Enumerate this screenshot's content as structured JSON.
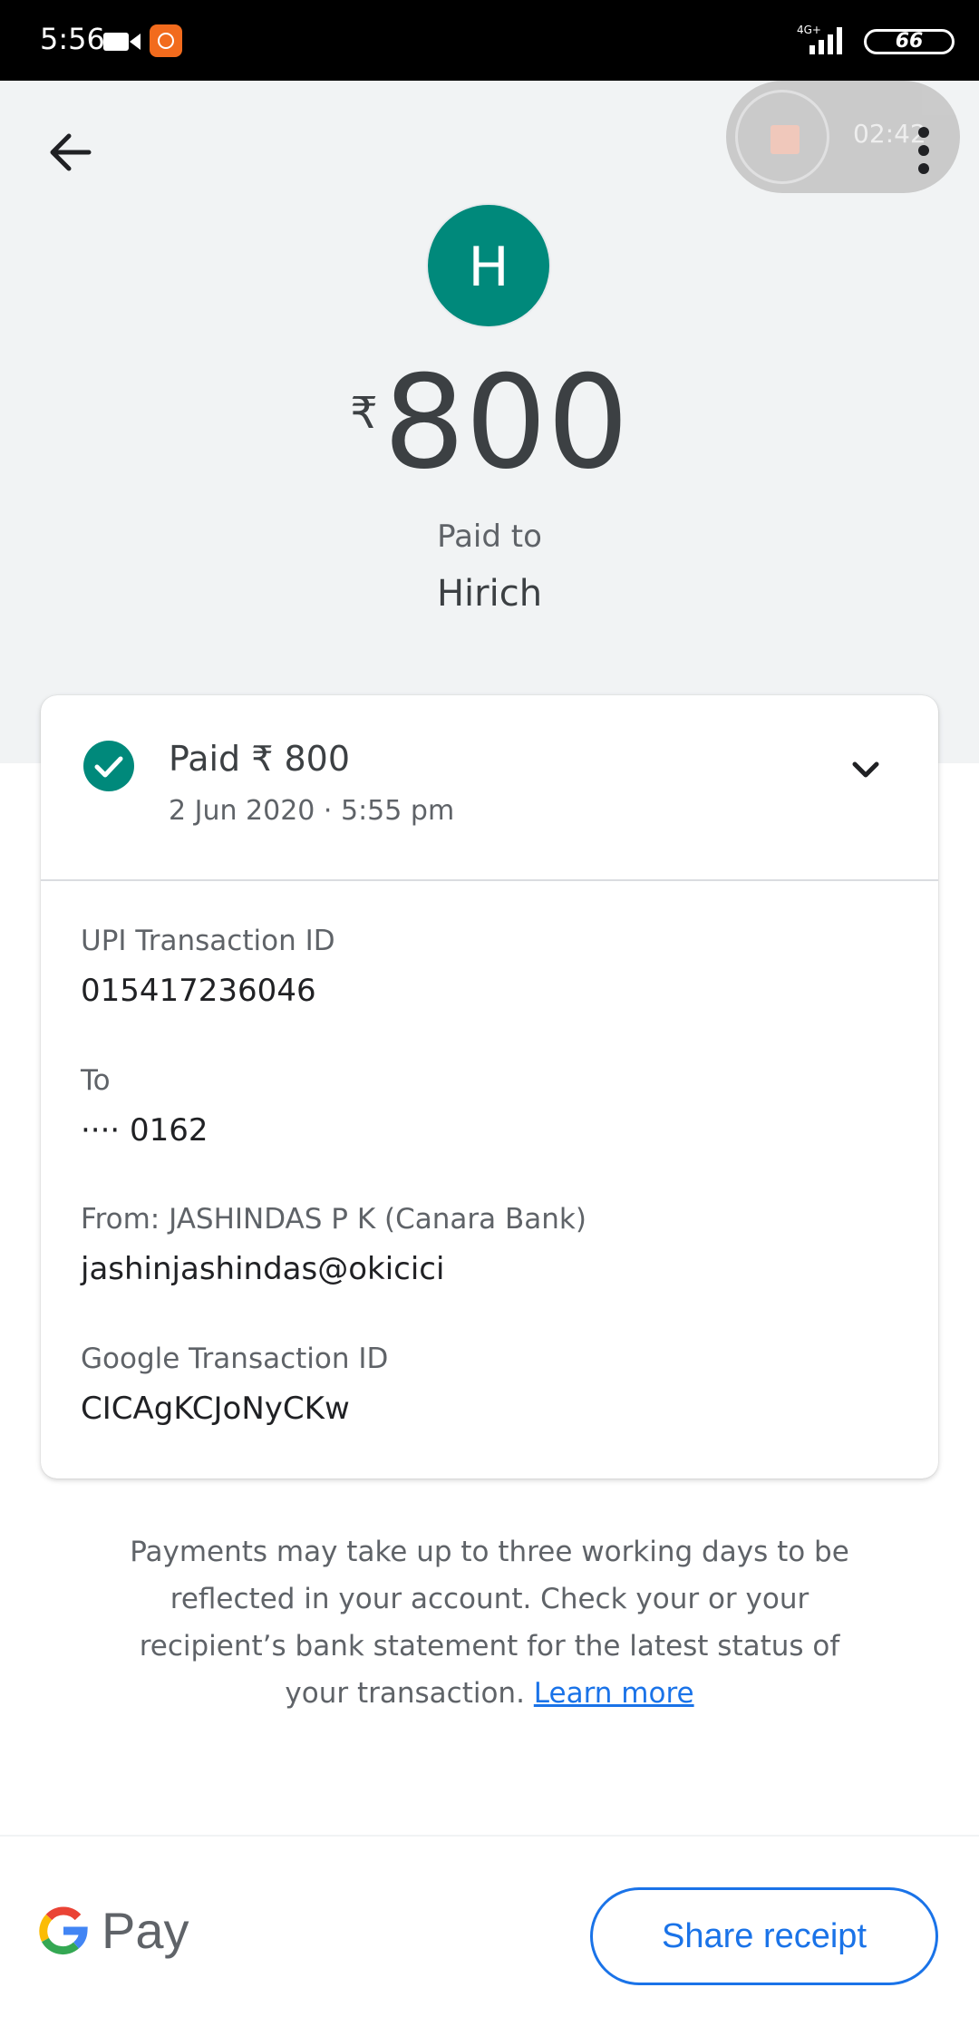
{
  "status_bar": {
    "time": "5:56",
    "network_label": "4G+",
    "battery": "66"
  },
  "recorder": {
    "timer": "02:42"
  },
  "header": {
    "avatar_letter": "H",
    "currency": "₹",
    "amount": "800",
    "paid_to_label": "Paid to",
    "payee": "Hirich"
  },
  "card": {
    "status_title": "Paid ₹ 800",
    "status_date": "2 Jun 2020 · 5:55 pm",
    "fields": [
      {
        "label": "UPI Transaction ID",
        "value": "015417236046"
      },
      {
        "label": "To",
        "value": "···· 0162"
      },
      {
        "label": "From: JASHINDAS P K (Canara Bank)",
        "value": "jashinjashindas@okicici"
      },
      {
        "label": "Google Transaction ID",
        "value": "CICAgKCJoNyCKw"
      }
    ]
  },
  "info": {
    "text": "Payments may take up to three working days to be reflected in your account. Check your or your recipient’s bank statement for the latest status of your transaction.",
    "link": "Learn more"
  },
  "footer": {
    "brand": "Pay",
    "share_label": "Share receipt"
  },
  "colors": {
    "accent": "#1a73e8",
    "success": "#00897b",
    "header_bg": "#f1f3f4"
  }
}
